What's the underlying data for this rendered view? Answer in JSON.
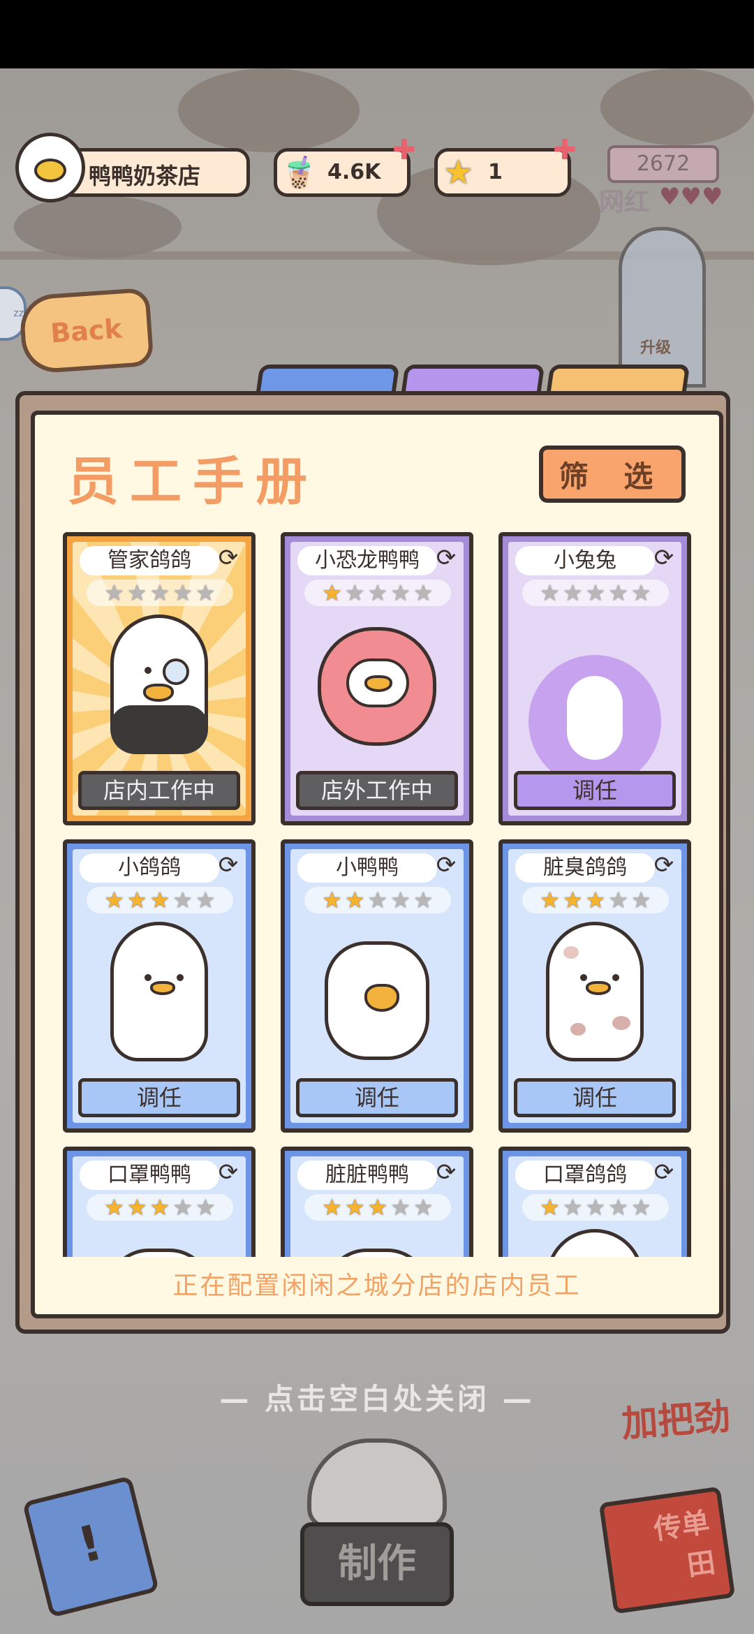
{
  "hud": {
    "shop_name": "鸭鸭奶茶店",
    "tea_count": "4.6K",
    "star_count": "1",
    "fan_count": "2672",
    "fan_label": "网红",
    "hearts": "♥♥♥"
  },
  "side_chip": "zz",
  "back_label": "Back",
  "tower_label": "升级",
  "panel": {
    "title": "员工手册",
    "filter_label": "筛 选",
    "tabs": [
      "blue",
      "purple",
      "orange"
    ],
    "footer": "正在配置闲闲之城分店的店内员工"
  },
  "employees": [
    {
      "name": "管家鸽鸽",
      "rarity": "orange",
      "stars": 0,
      "button": "店内工作中",
      "button_style": "gray"
    },
    {
      "name": "小恐龙鸭鸭",
      "rarity": "purple",
      "stars": 1,
      "button": "店外工作中",
      "button_style": "gray"
    },
    {
      "name": "小兔兔",
      "rarity": "purple",
      "stars": 0,
      "button": "调任",
      "button_style": "purple"
    },
    {
      "name": "小鸽鸽",
      "rarity": "blue",
      "stars": 3,
      "button": "调任",
      "button_style": "blue"
    },
    {
      "name": "小鸭鸭",
      "rarity": "blue",
      "stars": 2,
      "button": "调任",
      "button_style": "blue"
    },
    {
      "name": "脏臭鸽鸽",
      "rarity": "blue",
      "stars": 3,
      "button": "调任",
      "button_style": "blue"
    },
    {
      "name": "口罩鸭鸭",
      "rarity": "blue",
      "stars": 3,
      "button": "",
      "button_style": "blue"
    },
    {
      "name": "脏脏鸭鸭",
      "rarity": "blue",
      "stars": 3,
      "button": "",
      "button_style": "blue"
    },
    {
      "name": "口罩鸽鸽",
      "rarity": "blue",
      "stars": 1,
      "button": "",
      "button_style": "blue"
    }
  ],
  "close_hint": "— 点击空白处关闭 —",
  "bottom": {
    "cheer_label": "加把劲",
    "make_label": "制作",
    "flyer_label": "传单\n田",
    "book_icon_glyph": "!"
  },
  "colors": {
    "accent": "#f39c64",
    "outline": "#3b302c",
    "panel_bg": "#fff9e3",
    "card_blue": "#6c95e5",
    "card_purple": "#a58bd8",
    "card_orange": "#f4a440"
  }
}
